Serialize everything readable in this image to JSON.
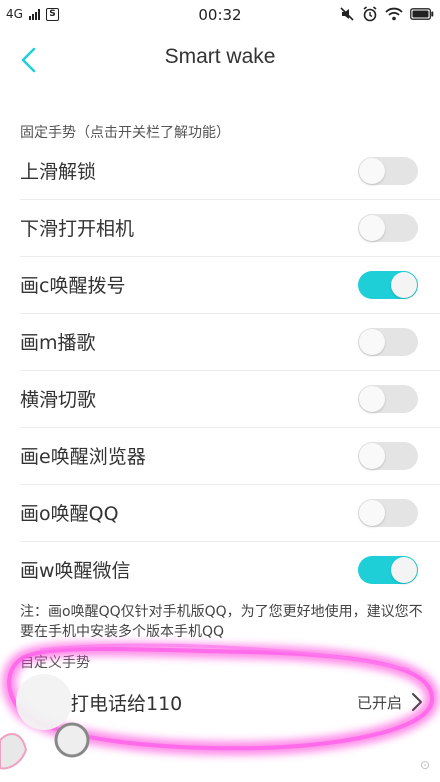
{
  "status_bar": {
    "network": "4G",
    "time": "00:32"
  },
  "nav": {
    "title": "Smart wake"
  },
  "fixed_section": {
    "header": "固定手势（点击开关栏了解功能）",
    "items": [
      {
        "label": "上滑解锁",
        "on": false
      },
      {
        "label": "下滑打开相机",
        "on": false
      },
      {
        "label": "画c唤醒拨号",
        "on": true
      },
      {
        "label": "画m播歌",
        "on": false
      },
      {
        "label": "横滑切歌",
        "on": false
      },
      {
        "label": "画e唤醒浏览器",
        "on": false
      },
      {
        "label": "画o唤醒QQ",
        "on": false
      },
      {
        "label": "画w唤醒微信",
        "on": true
      }
    ]
  },
  "note": "注：画o唤醒QQ仅针对手机版QQ，为了您更好地使用，建议您不要在手机中安装多个版本手机QQ",
  "custom_section": {
    "header": "自定义手势",
    "items": [
      {
        "label": "打电话给110",
        "status": "已开启"
      }
    ]
  },
  "colors": {
    "accent": "#1ecfd8",
    "toggle_off": "#e4e4e4",
    "highlight": "#ff44e0"
  },
  "icons": {
    "back": "chevron-left-icon",
    "row_arrow": "chevron-right-icon"
  }
}
